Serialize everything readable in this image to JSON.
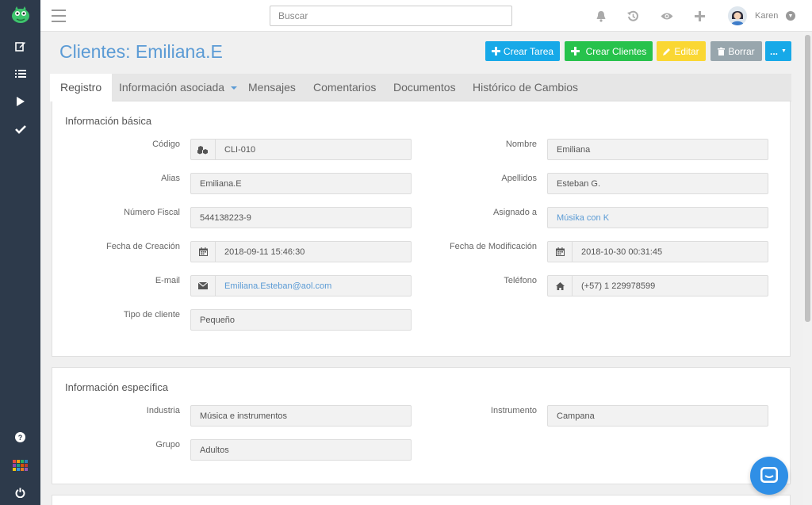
{
  "topbar": {
    "search_placeholder": "Buscar",
    "username": "Karen"
  },
  "icons": {
    "menu": "hamburger-icon",
    "notifications": "bell-icon",
    "history": "history-icon",
    "views": "eye-icon",
    "create": "plus-icon",
    "user": "user-avatar-icon"
  },
  "sidebar": {
    "items": [
      "edit-icon",
      "list-icon",
      "play-icon",
      "check-icon",
      "help-icon",
      "apps-icon",
      "power-icon"
    ]
  },
  "page": {
    "title": "Clientes: Emiliana.E"
  },
  "actions": {
    "crear_tarea": "Crear Tarea",
    "crear_clientes": "Crear Clientes",
    "editar": "Editar",
    "borrar": "Borrar",
    "more": "..."
  },
  "tabs": [
    {
      "label": "Registro",
      "active": true
    },
    {
      "label": "Información asociada",
      "active": false
    },
    {
      "label": "Mensajes",
      "active": false
    },
    {
      "label": "Comentarios",
      "active": false
    },
    {
      "label": "Documentos",
      "active": false
    },
    {
      "label": "Histórico de Cambios",
      "active": false
    }
  ],
  "basic": {
    "title": "Información básica",
    "codigo": {
      "label": "Código",
      "value": "CLI-010"
    },
    "nombre": {
      "label": "Nombre",
      "value": "Emiliana"
    },
    "alias": {
      "label": "Alias",
      "value": "Emiliana.E"
    },
    "apellidos": {
      "label": "Apellidos",
      "value": "Esteban G."
    },
    "numero_fiscal": {
      "label": "Número Fiscal",
      "value": "544138223-9"
    },
    "asignado": {
      "label": "Asignado a",
      "value": "Músika con K"
    },
    "fecha_creacion": {
      "label": "Fecha de Creación",
      "value": "2018-09-11 15:46:30"
    },
    "fecha_modificacion": {
      "label": "Fecha de Modificación",
      "value": "2018-10-30 00:31:45"
    },
    "email": {
      "label": "E-mail",
      "value": "Emiliana.Esteban@aol.com"
    },
    "telefono": {
      "label": "Teléfono",
      "value": "(+57) 1 229978599"
    },
    "tipo": {
      "label": "Tipo de cliente",
      "value": "Pequeño"
    }
  },
  "specific": {
    "title": "Información específica",
    "industria": {
      "label": "Industria",
      "value": "Música e instrumentos"
    },
    "instrumento": {
      "label": "Instrumento",
      "value": "Campana"
    },
    "grupo": {
      "label": "Grupo",
      "value": "Adultos"
    }
  },
  "colors": {
    "sidebar": "#2d3a4b",
    "accent": "#5b9bd5",
    "info": "#17a9e8",
    "success": "#27c24c",
    "warning": "#fad733",
    "muted": "#98a6ad"
  }
}
